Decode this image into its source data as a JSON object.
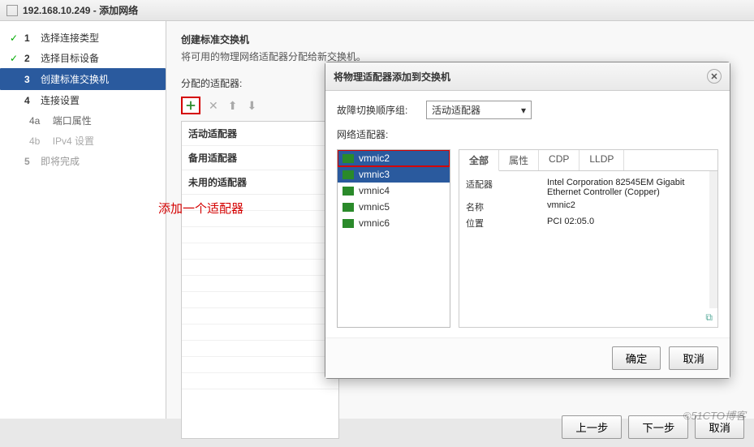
{
  "window": {
    "title": "192.168.10.249 - 添加网络"
  },
  "steps": {
    "s1": {
      "num": "1",
      "label": "选择连接类型"
    },
    "s2": {
      "num": "2",
      "label": "选择目标设备"
    },
    "s3": {
      "num": "3",
      "label": "创建标准交换机"
    },
    "s4": {
      "num": "4",
      "label": "连接设置"
    },
    "s4a": {
      "num": "4a",
      "label": "端口属性"
    },
    "s4b": {
      "num": "4b",
      "label": "IPv4 设置"
    },
    "s5": {
      "num": "5",
      "label": "即将完成"
    }
  },
  "content": {
    "heading": "创建标准交换机",
    "sub": "将可用的物理网络适配器分配给新交换机。",
    "assignedLabel": "分配的适配器:"
  },
  "annotation": "添加一个适配器",
  "adapterCats": {
    "active": "活动适配器",
    "standby": "备用适配器",
    "unused": "未用的适配器"
  },
  "dialog": {
    "title": "将物理适配器添加到交换机",
    "failoverLabel": "故障切换顺序组:",
    "failoverValue": "活动适配器",
    "nicLabel": "网络适配器:",
    "nics": [
      "vmnic2",
      "vmnic3",
      "vmnic4",
      "vmnic5",
      "vmnic6"
    ],
    "tabs": {
      "all": "全部",
      "prop": "属性",
      "cdp": "CDP",
      "lldp": "LLDP"
    },
    "props": {
      "adapter_k": "适配器",
      "adapter_v": "Intel Corporation 82545EM Gigabit Ethernet Controller (Copper)",
      "name_k": "名称",
      "name_v": "vmnic2",
      "loc_k": "位置",
      "loc_v": "PCI 02:05.0"
    },
    "ok": "确定",
    "cancel": "取消"
  },
  "footer": {
    "prev": "上一步",
    "next": "下一步",
    "cancelAll": "取消"
  },
  "watermark": "©51CTO博客"
}
